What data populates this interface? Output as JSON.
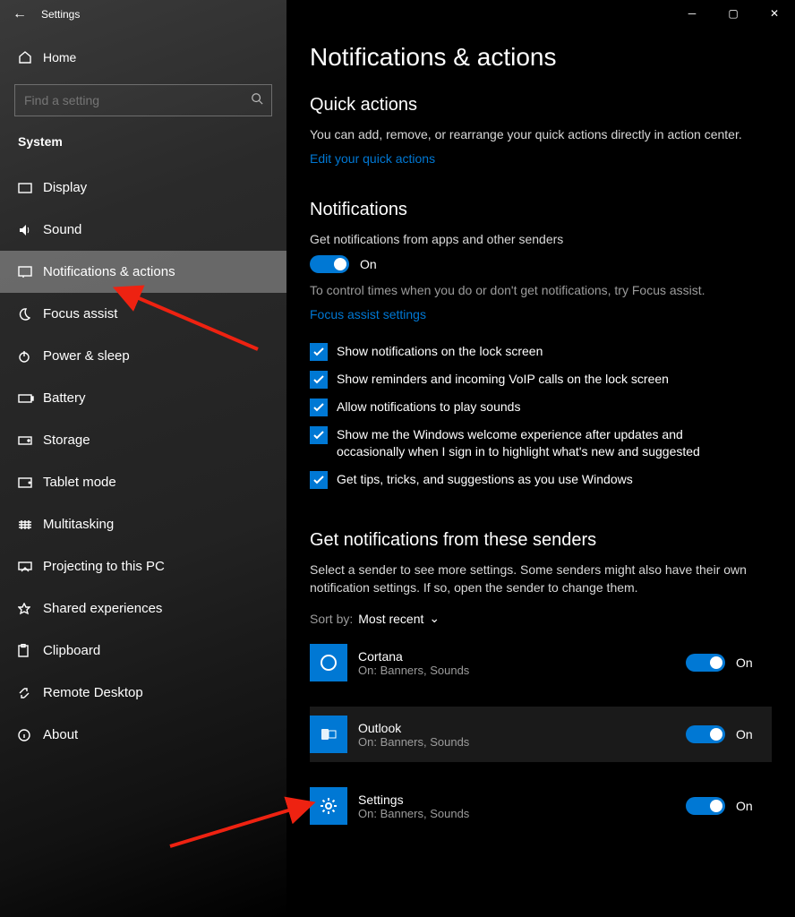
{
  "window": {
    "title": "Settings"
  },
  "sidebar": {
    "home": "Home",
    "search_placeholder": "Find a setting",
    "section": "System",
    "items": [
      {
        "label": "Display"
      },
      {
        "label": "Sound"
      },
      {
        "label": "Notifications & actions",
        "active": true
      },
      {
        "label": "Focus assist"
      },
      {
        "label": "Power & sleep"
      },
      {
        "label": "Battery"
      },
      {
        "label": "Storage"
      },
      {
        "label": "Tablet mode"
      },
      {
        "label": "Multitasking"
      },
      {
        "label": "Projecting to this PC"
      },
      {
        "label": "Shared experiences"
      },
      {
        "label": "Clipboard"
      },
      {
        "label": "Remote Desktop"
      },
      {
        "label": "About"
      }
    ]
  },
  "main": {
    "title": "Notifications & actions",
    "quick_actions": {
      "heading": "Quick actions",
      "blurb": "You can add, remove, or rearrange your quick actions directly in action center.",
      "link": "Edit your quick actions"
    },
    "notifications": {
      "heading": "Notifications",
      "desc": "Get notifications from apps and other senders",
      "toggle_state": "On",
      "hint": "To control times when you do or don't get notifications, try Focus assist.",
      "hint_link": "Focus assist settings",
      "checks": [
        "Show notifications on the lock screen",
        "Show reminders and incoming VoIP calls on the lock screen",
        "Allow notifications to play sounds",
        "Show me the Windows welcome experience after updates and occasionally when I sign in to highlight what's new and suggested",
        "Get tips, tricks, and suggestions as you use Windows"
      ]
    },
    "senders": {
      "heading": "Get notifications from these senders",
      "blurb": "Select a sender to see more settings. Some senders might also have their own notification settings. If so, open the sender to change them.",
      "sort_label": "Sort by:",
      "sort_value": "Most recent",
      "apps": [
        {
          "name": "Cortana",
          "detail": "On: Banners, Sounds",
          "state": "On"
        },
        {
          "name": "Outlook",
          "detail": "On: Banners, Sounds",
          "state": "On"
        },
        {
          "name": "Settings",
          "detail": "On: Banners, Sounds",
          "state": "On"
        }
      ]
    }
  }
}
